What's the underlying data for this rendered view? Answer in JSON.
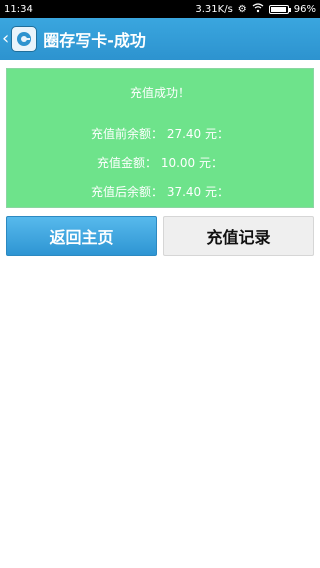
{
  "status": {
    "time": "11:34",
    "speed": "3.31K/s",
    "battery": "96%",
    "battery_level": 0.96
  },
  "header": {
    "title": "圈存写卡-成功"
  },
  "result": {
    "title": "充值成功！",
    "before": "充值前余额： 27.40 元：",
    "amount": "充值金额： 10.00 元：",
    "after": "充值后余额： 37.40 元："
  },
  "actions": {
    "home_label": "返回主页",
    "records_label": "充值记录"
  }
}
